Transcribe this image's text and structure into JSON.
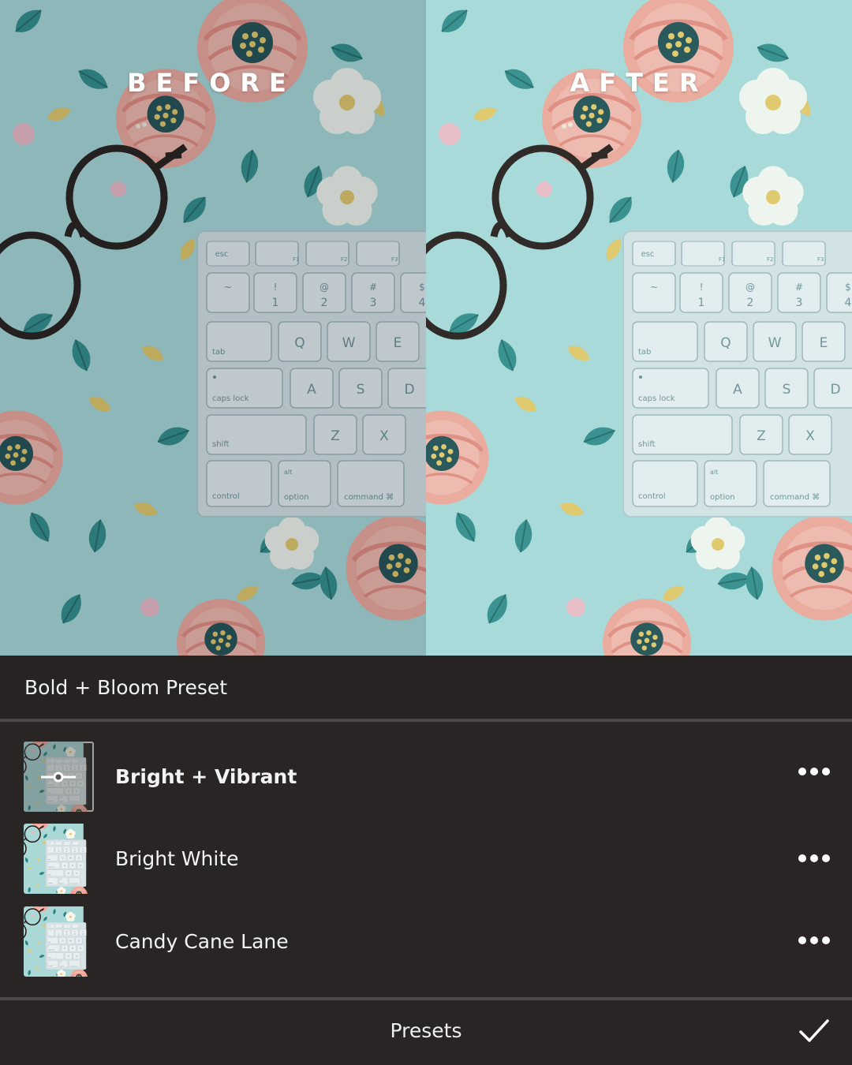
{
  "comparison": {
    "before_label": "BEFORE",
    "after_label": "AFTER",
    "keyboard_keys": {
      "esc": "esc",
      "tab": "tab",
      "caps": "caps lock",
      "shift": "shift",
      "control": "control",
      "alt": "alt",
      "option": "option",
      "command": "command ⌘",
      "q": "Q",
      "w": "W",
      "e": "E",
      "a": "A",
      "s": "S",
      "d": "D",
      "z": "Z",
      "x": "X",
      "n1": "1",
      "n2": "2",
      "n3": "3",
      "n4": "4",
      "s1": "!",
      "s2": "@",
      "s3": "#",
      "s4": "$",
      "tilde": "~",
      "f1": "F1",
      "f2": "F2",
      "f3": "F3"
    }
  },
  "header": {
    "title": "Bold + Bloom Preset"
  },
  "presets": [
    {
      "label": "Bright + Vibrant",
      "selected": true,
      "more_icon": "more-horizontal-icon"
    },
    {
      "label": "Bright White",
      "selected": false,
      "more_icon": "more-horizontal-icon"
    },
    {
      "label": "Candy Cane Lane",
      "selected": false,
      "more_icon": "more-horizontal-icon"
    }
  ],
  "footer": {
    "label": "Presets",
    "confirm_icon": "checkmark-icon"
  },
  "colors": {
    "panel": "#282524",
    "divider": "#4b4847",
    "wallpaper": "#a9d8d6",
    "accent_pink": "#f09a8e",
    "accent_teal": "#2f8a86"
  }
}
